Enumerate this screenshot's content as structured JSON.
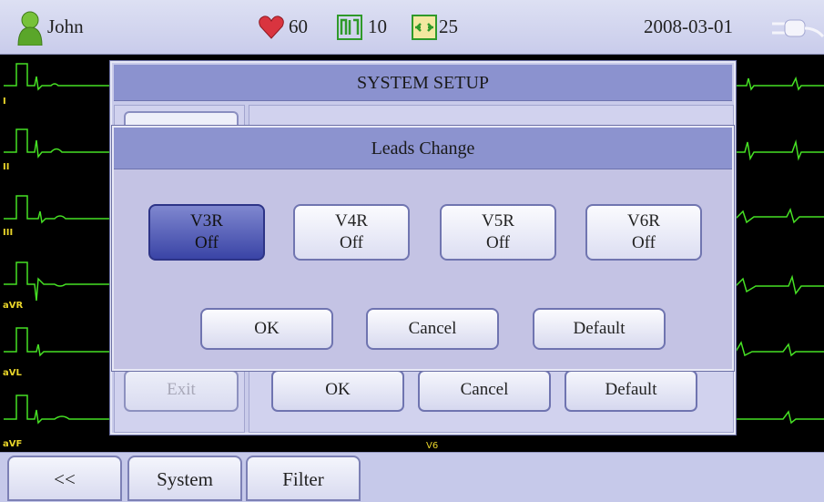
{
  "status_bar": {
    "patient_name": "John",
    "heart_rate": "60",
    "lead_count": "10",
    "sample_count": "25",
    "date": "2008-03-01",
    "colors": {
      "heart": "#d9343f",
      "ecg_trace": "#46e024",
      "lead_label": "#e9d52a"
    }
  },
  "leads": {
    "labels": [
      "I",
      "II",
      "III",
      "aVR",
      "aVL",
      "aVF"
    ],
    "v6_label": "V6"
  },
  "system_setup": {
    "title": "SYSTEM SETUP",
    "exit_label": "Exit",
    "ok_label": "OK",
    "cancel_label": "Cancel",
    "default_label": "Default"
  },
  "leads_change": {
    "title": "Leads Change",
    "options": [
      {
        "name": "V3R",
        "state": "Off",
        "selected": true
      },
      {
        "name": "V4R",
        "state": "Off",
        "selected": false
      },
      {
        "name": "V5R",
        "state": "Off",
        "selected": false
      },
      {
        "name": "V6R",
        "state": "Off",
        "selected": false
      }
    ],
    "ok_label": "OK",
    "cancel_label": "Cancel",
    "default_label": "Default"
  },
  "bottom_tabs": {
    "back_label": "<<",
    "system_label": "System",
    "filter_label": "Filter"
  }
}
